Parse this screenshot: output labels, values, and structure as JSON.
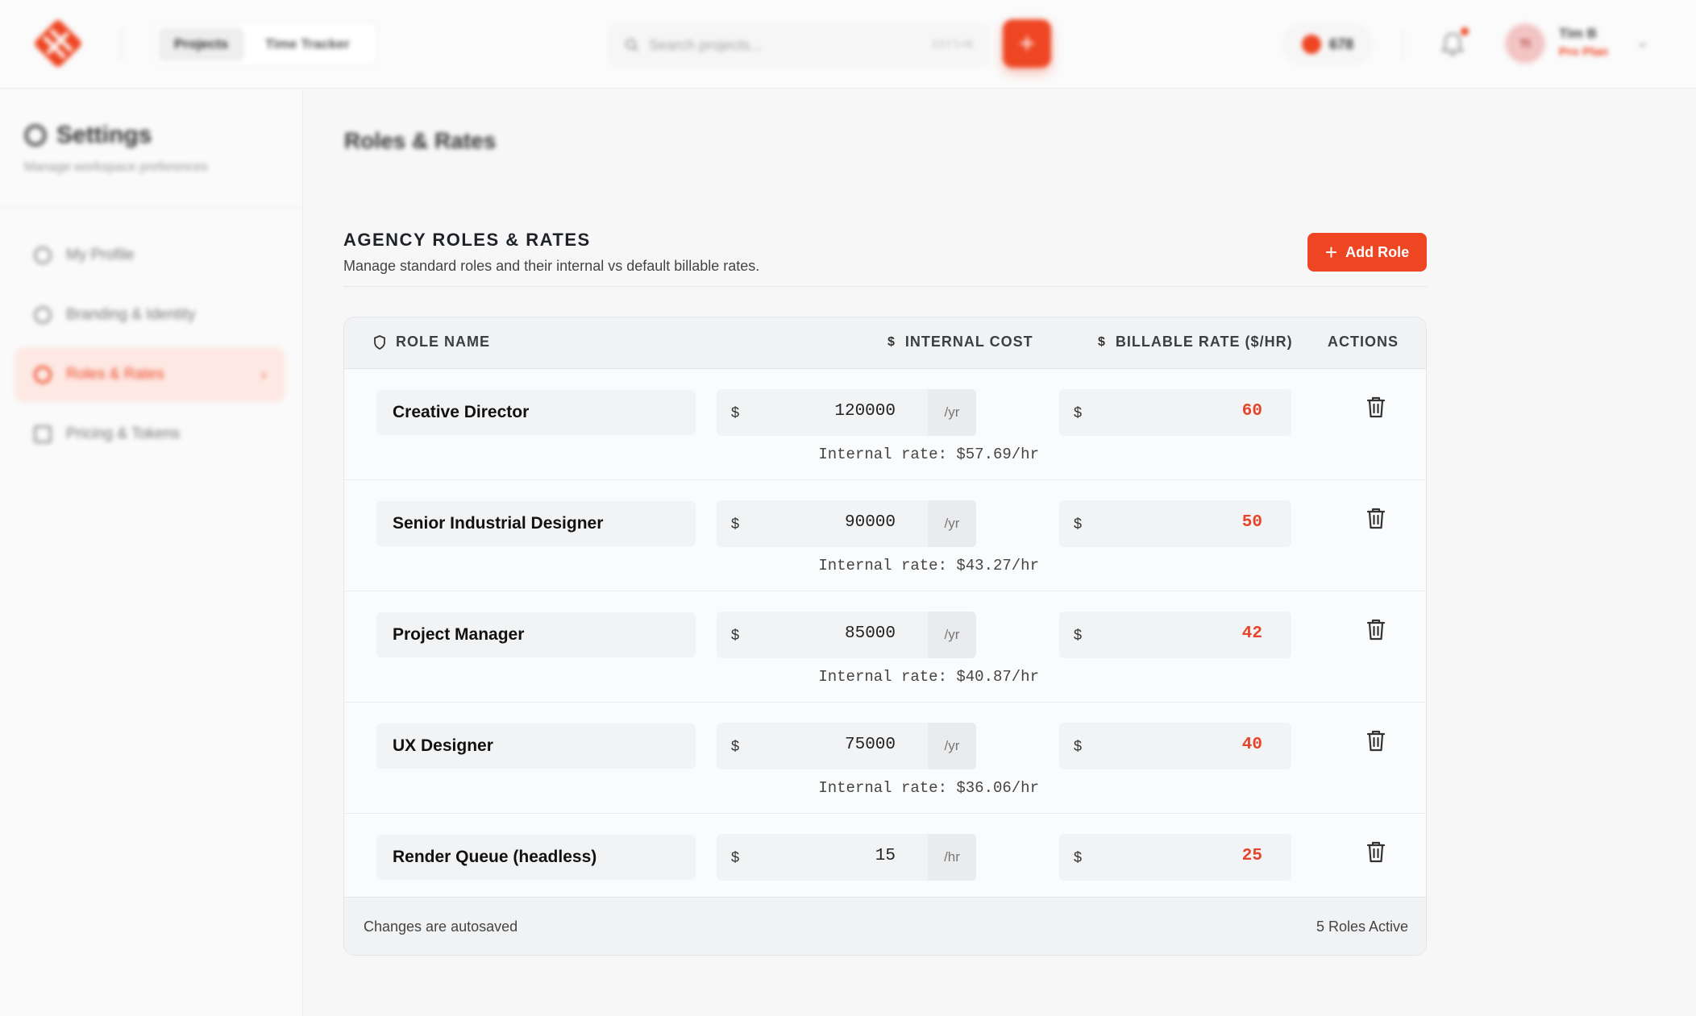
{
  "topbar": {
    "nav_tabs": [
      {
        "label": "Projects",
        "active": true
      },
      {
        "label": "Time Tracker",
        "active": false
      }
    ],
    "search_placeholder": "Search projects...",
    "search_shortcut": "Ctrl+K",
    "add_icon": "plus-icon",
    "tokens": "678",
    "user": {
      "initials": "TI",
      "name": "Tim B",
      "plan": "Pro Plan"
    }
  },
  "sidebar": {
    "title": "Settings",
    "subtitle": "Manage workspace preferences",
    "items": [
      {
        "label": "My Profile",
        "icon": "user-icon",
        "active": false
      },
      {
        "label": "Branding & Identity",
        "icon": "globe-icon",
        "active": false
      },
      {
        "label": "Roles & Rates",
        "icon": "shield-icon",
        "active": true
      },
      {
        "label": "Pricing & Tokens",
        "icon": "card-icon",
        "active": false
      }
    ]
  },
  "main": {
    "page_title": "Roles & Rates",
    "section_title": "AGENCY ROLES & RATES",
    "section_subtitle": "Manage standard roles and their internal vs default billable rates.",
    "add_role_label": "Add Role"
  },
  "table": {
    "headers": {
      "role": "ROLE NAME",
      "internal": "INTERNAL COST",
      "billable": "BILLABLE RATE ($/HR)",
      "actions": "ACTIONS"
    },
    "currency": "$",
    "rows": [
      {
        "role": "Creative Director",
        "cost": "120000",
        "unit": "/yr",
        "internal_rate": "Internal rate: $57.69/hr",
        "billable": "60"
      },
      {
        "role": "Senior Industrial Designer",
        "cost": "90000",
        "unit": "/yr",
        "internal_rate": "Internal rate: $43.27/hr",
        "billable": "50"
      },
      {
        "role": "Project Manager",
        "cost": "85000",
        "unit": "/yr",
        "internal_rate": "Internal rate: $40.87/hr",
        "billable": "42"
      },
      {
        "role": "UX Designer",
        "cost": "75000",
        "unit": "/yr",
        "internal_rate": "Internal rate: $36.06/hr",
        "billable": "40"
      },
      {
        "role": "Render Queue (headless)",
        "cost": "15",
        "unit": "/hr",
        "internal_rate": "",
        "billable": "25"
      }
    ],
    "footer_left": "Changes are autosaved",
    "footer_right": "5 Roles Active"
  },
  "colors": {
    "accent": "#ee4623",
    "billable_text": "#e5452a"
  }
}
